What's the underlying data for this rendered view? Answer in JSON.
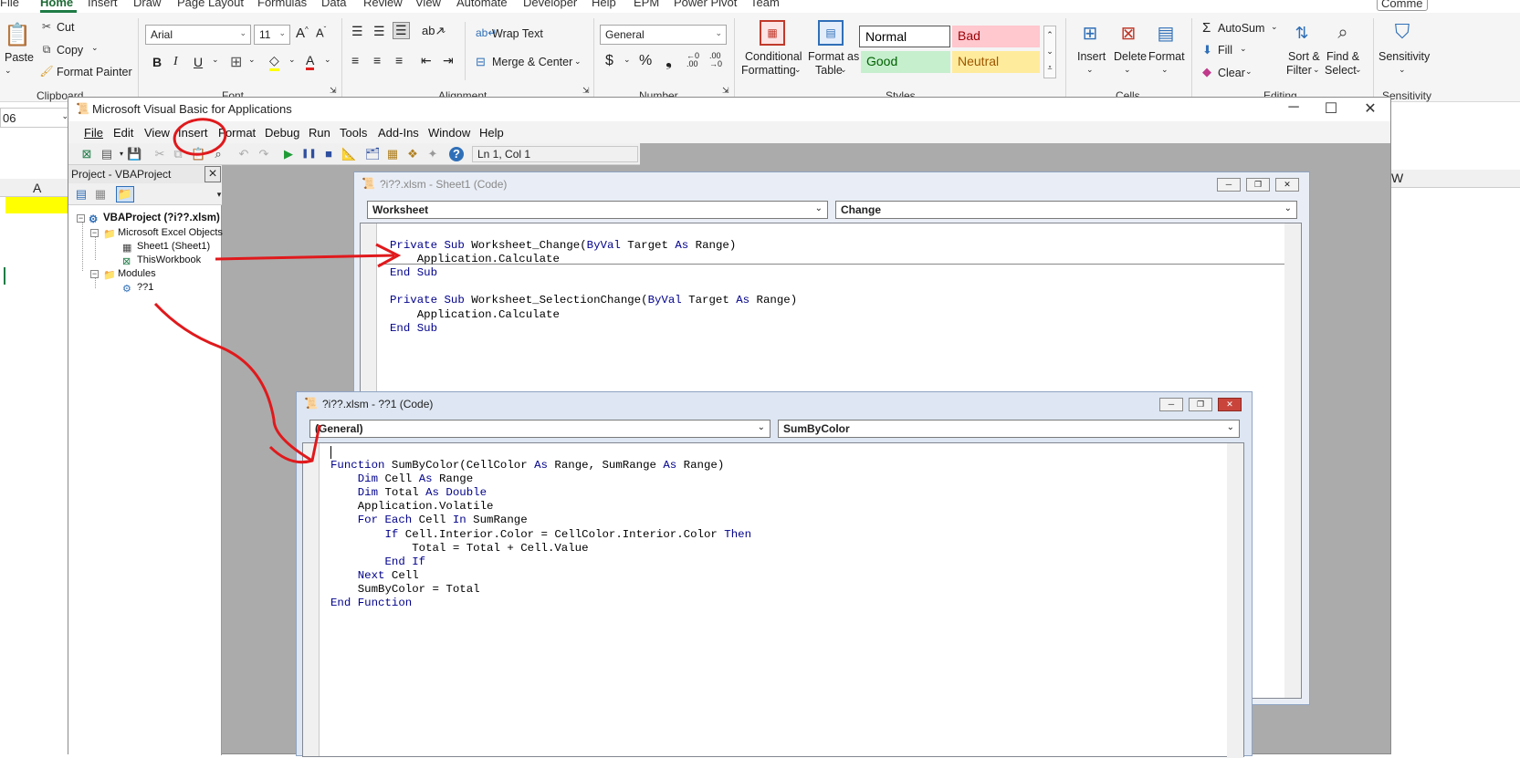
{
  "excel": {
    "tabs": [
      "File",
      "Home",
      "Insert",
      "Draw",
      "Page Layout",
      "Formulas",
      "Data",
      "Review",
      "View",
      "Automate",
      "Developer",
      "Help",
      "EPM",
      "Power Pivot",
      "Team"
    ],
    "comments_label": "Comme",
    "clipboard": {
      "paste": "Paste",
      "cut": "Cut",
      "copy": "Copy",
      "format_painter": "Format Painter",
      "label": "Clipboard"
    },
    "font": {
      "name": "Arial",
      "size": "11",
      "label": "Font"
    },
    "alignment": {
      "wrap_text": "Wrap Text",
      "merge_center": "Merge & Center",
      "label": "Alignment"
    },
    "number": {
      "format": "General",
      "label": "Number"
    },
    "styles": {
      "conditional_1": "Conditional",
      "conditional_2": "Formatting",
      "format_table_1": "Format as",
      "format_table_2": "Table",
      "normal": "Normal",
      "bad": "Bad",
      "good": "Good",
      "neutral": "Neutral",
      "label": "Styles"
    },
    "cells": {
      "insert": "Insert",
      "delete": "Delete",
      "format": "Format",
      "label": "Cells"
    },
    "editing": {
      "autosum": "AutoSum",
      "fill": "Fill",
      "clear": "Clear",
      "sort_1": "Sort &",
      "sort_2": "Filter",
      "find_1": "Find &",
      "find_2": "Select",
      "label": "Editing"
    },
    "sensitivity": {
      "button": "Sensitivity",
      "label": "Sensitivity"
    },
    "name_box": "06",
    "column_a": "A",
    "column_w": "W"
  },
  "vba": {
    "title": "Microsoft Visual Basic for Applications",
    "menu": [
      "File",
      "Edit",
      "View",
      "Insert",
      "Format",
      "Debug",
      "Run",
      "Tools",
      "Add-Ins",
      "Window",
      "Help"
    ],
    "position": "Ln 1, Col 1",
    "project": {
      "title": "Project - VBAProject",
      "root": "VBAProject (?i??.xlsm)",
      "excel_objects": "Microsoft Excel Objects",
      "sheet1": "Sheet1 (Sheet1)",
      "thisworkbook": "ThisWorkbook",
      "modules": "Modules",
      "module1": "??1"
    },
    "sheet_window": {
      "title": "?i??.xlsm - Sheet1 (Code)",
      "object": "Worksheet",
      "procedure": "Change",
      "code": [
        "Private Sub Worksheet_Change(ByVal Target As Range)",
        "    Application.Calculate",
        "End Sub",
        "",
        "Private Sub Worksheet_SelectionChange(ByVal Target As Range)",
        "    Application.Calculate",
        "End Sub"
      ]
    },
    "module_window": {
      "title": "?i??.xlsm - ??1 (Code)",
      "object": "(General)",
      "procedure": "SumByColor",
      "code": [
        "Function SumByColor(CellColor As Range, SumRange As Range)",
        "    Dim Cell As Range",
        "    Dim Total As Double",
        "    Application.Volatile",
        "    For Each Cell In SumRange",
        "        If Cell.Interior.Color = CellColor.Interior.Color Then",
        "            Total = Total + Cell.Value",
        "        End If",
        "    Next Cell",
        "    SumByColor = Total",
        "End Function"
      ]
    }
  },
  "colors": {
    "annotation": "#e0191c",
    "keyword": "#00008b",
    "excel_green": "#1e7b45",
    "highlight_yellow": "#ffff00"
  }
}
